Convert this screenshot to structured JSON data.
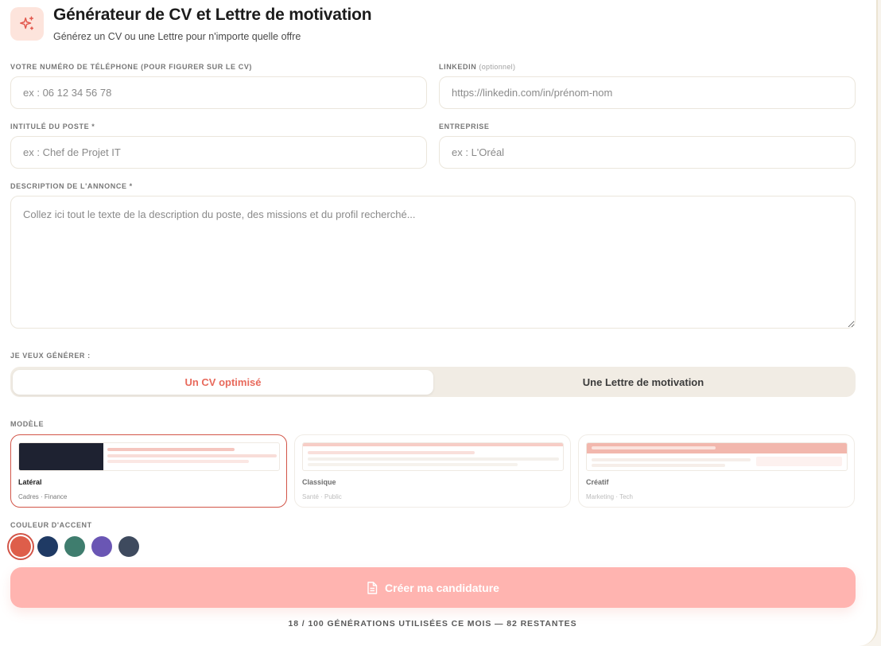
{
  "header": {
    "icon": "sparkles-icon",
    "title": "Générateur de CV et Lettre de motivation",
    "subtitle": "Générez un CV ou une Lettre pour n'importe quelle offre"
  },
  "form": {
    "phone": {
      "label": "VOTRE NUMÉRO DE TÉLÉPHONE (POUR FIGURER SUR LE CV)",
      "placeholder": "ex : 06 12 34 56 78",
      "value": ""
    },
    "linkedin": {
      "label": "LINKEDIN",
      "optional": "(optionnel)",
      "placeholder": "https://linkedin.com/in/prénom-nom",
      "value": ""
    },
    "job_title": {
      "label": "INTITULÉ DU POSTE *",
      "placeholder": "ex : Chef de Projet IT",
      "value": ""
    },
    "company": {
      "label": "ENTREPRISE",
      "placeholder": "ex : L'Oréal",
      "value": ""
    },
    "description": {
      "label": "DESCRIPTION DE L'ANNONCE *",
      "placeholder": "Collez ici tout le texte de la description du poste, des missions et du profil recherché...",
      "value": ""
    }
  },
  "generate": {
    "label": "JE VEUX GÉNÉRER :",
    "options": [
      "Un CV optimisé",
      "Une Lettre de motivation"
    ],
    "selected": "Un CV optimisé"
  },
  "templates": {
    "label": "MODÈLE",
    "items": [
      {
        "name": "Latéral",
        "sub": "Cadres · Finance",
        "selected": true
      },
      {
        "name": "Classique",
        "sub": "Santé · Public",
        "selected": false
      },
      {
        "name": "Créatif",
        "sub": "Marketing · Tech",
        "selected": false
      }
    ]
  },
  "accent": {
    "label": "COULEUR D'ACCENT",
    "colors": [
      "#de5e4a",
      "#1f3a64",
      "#3f7d6e",
      "#6a56b4",
      "#3e4a5e"
    ],
    "selected": "#de5e4a"
  },
  "cta": {
    "label": "Créer ma candidature",
    "icon": "document-icon"
  },
  "usage": {
    "text": "18 / 100 GÉNÉRATIONS UTILISÉES CE MOIS — 82 RESTANTES",
    "used": 18,
    "total": 100,
    "remaining": 82
  }
}
